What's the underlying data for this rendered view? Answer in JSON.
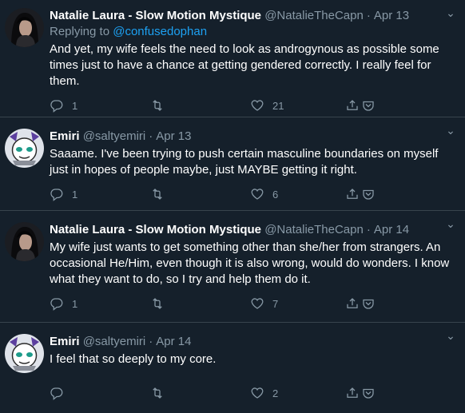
{
  "tweets": [
    {
      "name": "Natalie Laura - Slow Motion Mystique",
      "handle": "@NatalieTheCapn",
      "date": "Apr 13",
      "replying_prefix": "Replying to",
      "replying_to": "@confusedophan",
      "text": "And yet, my wife feels the need to look as androgynous as possible some times just to have a chance at getting gendered correctly.  I really feel for them.",
      "replies": "1",
      "retweets": "",
      "likes": "21",
      "avatar": "dark-haired-person"
    },
    {
      "name": "Emiri",
      "handle": "@saltyemiri",
      "date": "Apr 13",
      "text": "Saaame. I've been trying to push certain masculine boundaries on myself just in hopes of people maybe, just MAYBE getting it right.",
      "replies": "1",
      "retweets": "",
      "likes": "6",
      "avatar": "cartoon-creature"
    },
    {
      "name": "Natalie Laura - Slow Motion Mystique",
      "handle": "@NatalieTheCapn",
      "date": "Apr 14",
      "text": "My wife just wants to get something other than she/her from strangers.  An occasional He/Him, even though it is also wrong, would do wonders.  I know what they want to do, so I try and help them do it.",
      "replies": "1",
      "retweets": "",
      "likes": "7",
      "avatar": "dark-haired-person"
    },
    {
      "name": "Emiri",
      "handle": "@saltyemiri",
      "date": "Apr 14",
      "text": "I feel that so deeply to my core.",
      "replies": "",
      "retweets": "",
      "likes": "2",
      "avatar": "cartoon-creature"
    }
  ],
  "colors": {
    "background": "#15202b",
    "muted": "#8899a6",
    "link": "#1da1f2",
    "divider": "#38444d"
  }
}
